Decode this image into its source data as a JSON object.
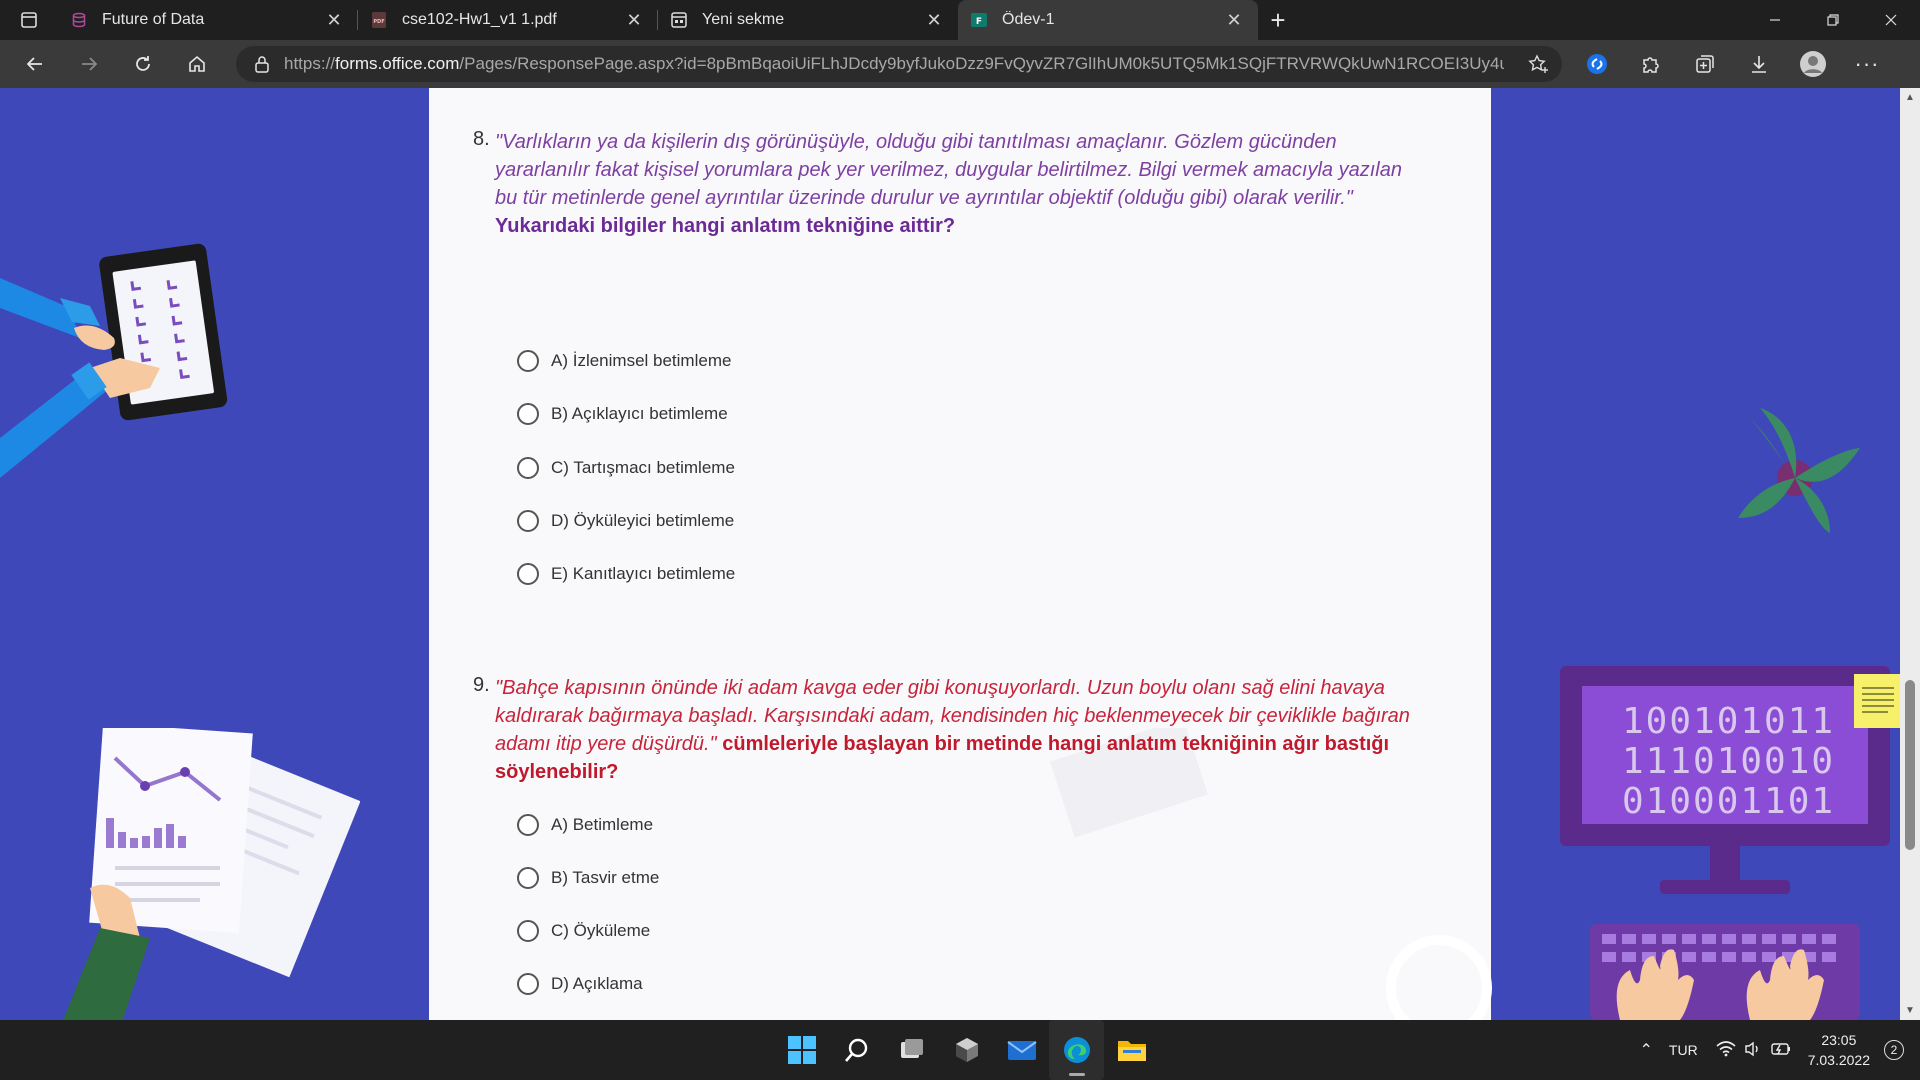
{
  "tabs": [
    {
      "title": "Future of Data",
      "icon": "database-icon"
    },
    {
      "title": "cse102-Hw1_v1 1.pdf",
      "icon": "pdf-icon"
    },
    {
      "title": "Yeni sekme",
      "icon": "new-tab-page-icon"
    },
    {
      "title": "Ödev-1",
      "icon": "forms-icon",
      "active": true
    }
  ],
  "address": {
    "url_prefix": "https://",
    "url_host": "forms.office.com",
    "url_path": "/Pages/ResponsePage.aspx?id=8pBmBqaoiUiFLhJDcdy9byfJukoDzz9FvQyvZR7GlIhUM0k5UTQ5Mk1SQjFTRVRWQkUwN1RCOEI3Uy4u"
  },
  "questions": [
    {
      "number": "8.",
      "text": "\"Varlıkların ya da kişilerin dış görünüşüyle, olduğu gibi tanıtılması amaçlanır. Gözlem gücünden yararlanılır fakat kişisel yorumlara pek yer verilmez, duygular belirtilmez. Bilgi vermek amacıyla yazılan bu tür metinlerde genel ayrıntılar üzerinde durulur ve ayrıntılar objektif (olduğu gibi) olarak verilir.\"",
      "bold": "Yukarıdaki bilgiler hangi anlatım tekniğine aittir?",
      "options": [
        "A) İzlenimsel betimleme",
        "B) Açıklayıcı betimleme",
        "C) Tartışmacı betimleme",
        "D) Öyküleyici betimleme",
        "E) Kanıtlayıcı betimleme"
      ]
    },
    {
      "number": "9.",
      "text": "\"Bahçe kapısının önünde iki adam kavga eder gibi konuşuyorlardı. Uzun boylu olanı sağ elini havaya kaldırarak bağırmaya başladı. Karşısındaki adam, kendisinden hiç beklenmeyecek bir çeviklikle bağıran adamı itip yere düşürdü.\"",
      "bold": "cümleleriyle başlayan bir metinde hangi anlatım tekniğinin ağır bastığı söylenebilir?",
      "options": [
        "A) Betimleme",
        "B) Tasvir etme",
        "C) Öyküleme",
        "D) Açıklama"
      ]
    }
  ],
  "decoration": {
    "binary": [
      "100101011",
      "111010010",
      "010001101"
    ]
  },
  "taskbar": {
    "language": "TUR",
    "time": "23:05",
    "date": "7.03.2022",
    "notifications": "2"
  },
  "colors": {
    "background": "#3f48b8",
    "question8_text": "#7e3fa3",
    "question9_text": "#c7243a"
  }
}
